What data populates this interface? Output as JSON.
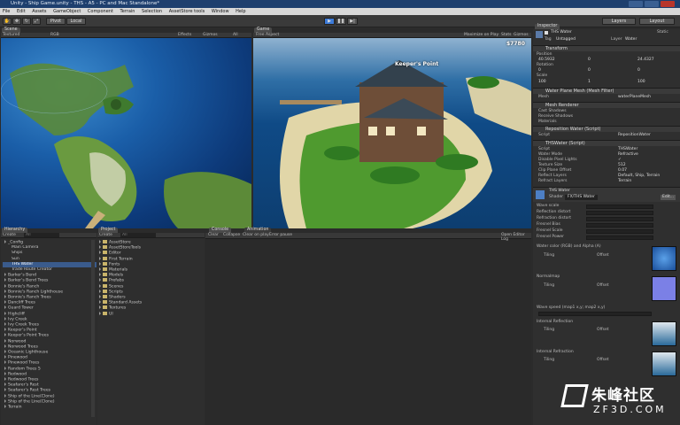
{
  "window": {
    "title": "Unity - Ship Game.unity - THS - A5 - PC and Mac Standalone*"
  },
  "menu": [
    "File",
    "Edit",
    "Assets",
    "GameObject",
    "Component",
    "Terrain",
    "Selection",
    "AssetStore tools",
    "Window",
    "Help"
  ],
  "toolbar": {
    "play_icon": "play-icon",
    "pause_icon": "pause-icon",
    "step_icon": "step-icon",
    "layers": "Layers",
    "layout": "Layout"
  },
  "scene": {
    "tab": "Scene",
    "shading": "Textured",
    "render": "RGB",
    "stats_label": "Effects",
    "gizmos": "Gizmos",
    "search": "All"
  },
  "game": {
    "tab": "Game",
    "aspect": "Free Aspect",
    "maximize": "Maximize on Play",
    "stats": "Stats",
    "gizmos": "Gizmos",
    "label": "Keeper's Point",
    "counter": "$7780"
  },
  "hierarchy": {
    "tab": "Hierarchy",
    "create": "Create",
    "search": "All",
    "items": [
      "_Config",
      "Main Camera",
      "Ships",
      "Sun",
      "THS Water",
      "Trade Route Creator",
      "Barker's Bend",
      "Barker's Bend Trees",
      "Bonnie's Ranch",
      "Bonnie's Ranch Lighthouse",
      "Bonnie's Ranch Trees",
      "Dancliff Trees",
      "Guard Tower",
      "Highcliff",
      "Ivy Creek",
      "Ivy Creek Trees",
      "Keeper's Point",
      "Keeper's Point Trees",
      "Norwood",
      "Norwood Trees",
      "Oceanic Lighthouse",
      "Pinewood",
      "Pinewood Trees",
      "Random Trees 5",
      "Redwood",
      "Redwood Trees",
      "Seafarer's Rest",
      "Seafarer's Rest Trees",
      "Ship of the Line(Clone)",
      "Ship of the Line(Clone)",
      "Terrain"
    ]
  },
  "project": {
    "tab": "Project",
    "create": "Create",
    "search": "All",
    "items": [
      "AssetStore",
      "AssetStoreTools",
      "Editor",
      "First Terrain",
      "Fonts",
      "Materials",
      "Models",
      "Prefabs",
      "Scenes",
      "Scripts",
      "Shaders",
      "Standard Assets",
      "Textures",
      "UI"
    ]
  },
  "console": {
    "tab": "Console",
    "tab2": "Animation",
    "buttons": [
      "Clear",
      "Collapse",
      "Clear on play",
      "Error pause"
    ],
    "open_log": "Open Editor Log"
  },
  "inspector": {
    "tab": "Inspector",
    "object_name": "THS Water",
    "static": "Static",
    "tag_label": "Tag",
    "tag": "Untagged",
    "layer_label": "Layer",
    "layer": "Water",
    "transform": {
      "title": "Transform",
      "position": "Position",
      "pos": [
        "40.5932",
        "0",
        "24.4327"
      ],
      "rotation": "Rotation",
      "rot": [
        "0",
        "0",
        "0"
      ],
      "scale": "Scale",
      "scl": [
        "100",
        "1",
        "100"
      ]
    },
    "mesh_filter": {
      "title": "Water Plane Mesh (Mesh Filter)",
      "mesh_label": "Mesh",
      "mesh": "waterPlaneMesh"
    },
    "mesh_renderer": {
      "title": "Mesh Renderer",
      "cast": "Cast Shadows",
      "receive": "Receive Shadows",
      "materials": "Materials"
    },
    "reposition": {
      "title": "Reposition Water (Script)",
      "script_label": "Script",
      "script": "RepositionWater"
    },
    "ths_water": {
      "title": "THSWater (Script)",
      "rows": [
        [
          "Script",
          "THSWater"
        ],
        [
          "Water Mode",
          "Refractive"
        ],
        [
          "Disable Pixel Lights",
          "✓"
        ],
        [
          "Texture Size",
          "512"
        ],
        [
          "Clip Plane Offset",
          "0.07"
        ],
        [
          "Reflect Layers",
          "Default, Ship, Terrain"
        ],
        [
          "Refract Layers",
          "Terrain"
        ]
      ]
    },
    "material": {
      "name": "THS Water",
      "shader_label": "Shader",
      "shader": "FX/THS Water",
      "edit": "Edit..."
    },
    "props": [
      "Wave scale",
      "Reflection distort",
      "Refraction distort",
      "Fresnel Bias",
      "Fresnel Scale",
      "Fresnel Power",
      "Water color (RGB) and Alpha (A)",
      "Normalmap",
      "Wave speed (map1 x,y; map2 x,y)",
      "Internal Reflection",
      "Internal Refraction"
    ],
    "tiling": "Tiling",
    "offset": "Offset",
    "select": "Select"
  },
  "watermark": {
    "brand": "朱峰社区",
    "domain": "ZF3D.COM"
  },
  "colors": {
    "accent": "#3d7bd8",
    "title_bar": "#1e3f6e",
    "panel": "#2f2f2f"
  }
}
